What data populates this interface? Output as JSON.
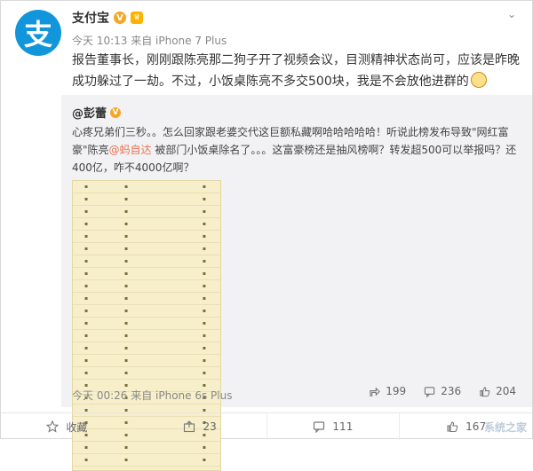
{
  "header": {
    "avatar_char": "支",
    "name": "支付宝",
    "verified_mark": "V",
    "time_source": "今天 10:13 来自 iPhone 7 Plus",
    "chevron": "⌄"
  },
  "post": {
    "text": "报告董事长，刚刚跟陈亮那二狗子开了视频会议，目测精神状态尚可，应该是昨晚成功躲过了一劫。不过，小饭桌陈亮不多交500块，我是不会放他进群的"
  },
  "repost": {
    "author": "@彭蕾",
    "verified_mark": "V",
    "text_before_link": "心疼兄弟们三秒。。怎么回家跟老婆交代这巨额私藏啊哈哈哈哈哈！听说此榜发布导致\"网红富豪\"陈亮",
    "link": "@蚂自达",
    "text_after_link": " 被部门小饭桌除名了。。。这富豪榜还是抽风榜啊？转发超500可以举报吗？还400亿，咋不4000亿啊？",
    "time_source": "今天 00:26 来自 iPhone 6s Plus",
    "actions": {
      "share_count": "199",
      "comment_count": "236",
      "like_count": "204"
    }
  },
  "bottom_bar": {
    "favorite_label": "收藏",
    "share_count": "23",
    "comment_count": "111",
    "like_count": "167"
  },
  "watermark": "系统之家",
  "colors": {
    "alipay_blue": "#1296db",
    "verified_orange": "#f5a623",
    "link_orange": "#eb7350",
    "repost_bg": "#f2f2f5"
  }
}
